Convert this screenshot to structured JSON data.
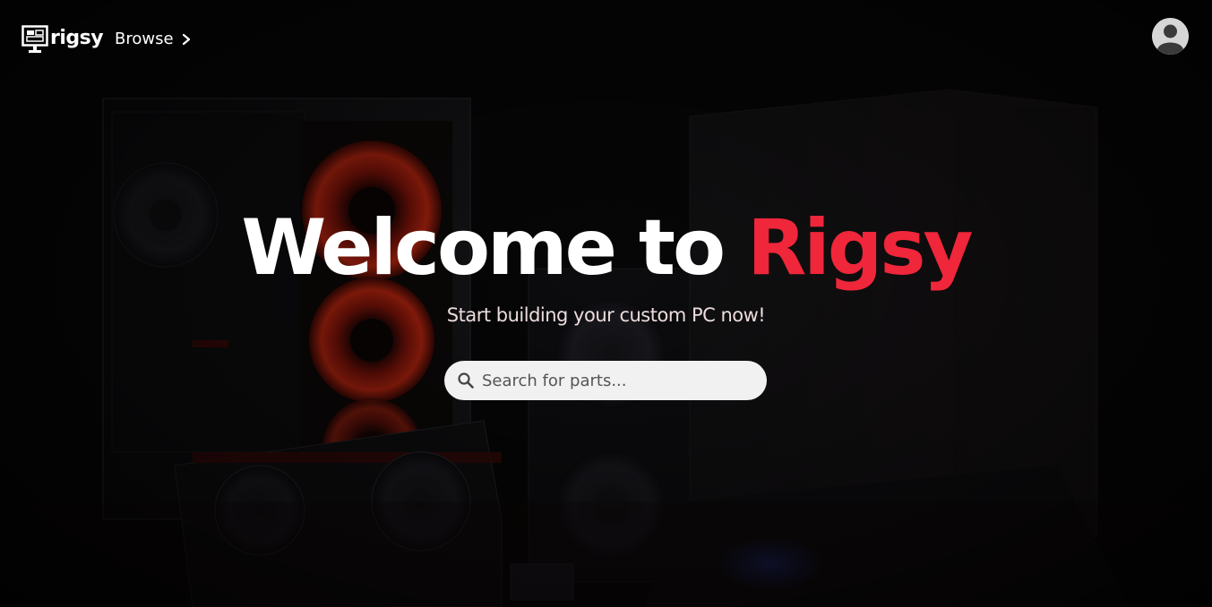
{
  "brand": {
    "name": "rigsy",
    "icon": "monitor-logo-icon",
    "accent_color": "#f0263a"
  },
  "nav": {
    "browse_label": "Browse",
    "browse_icon": "chevron-right-icon",
    "profile_icon": "user-avatar-icon"
  },
  "hero": {
    "title_prefix": "Welcome to ",
    "title_brand": "Rigsy",
    "subtitle": "Start building your custom PC now!"
  },
  "search": {
    "icon": "search-icon",
    "placeholder": "Search for parts...",
    "value": ""
  }
}
